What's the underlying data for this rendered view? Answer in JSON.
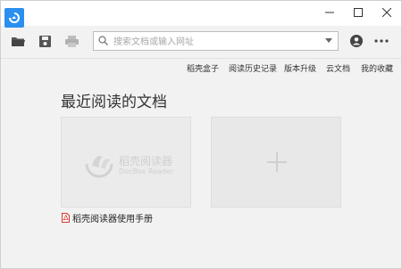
{
  "window": {
    "minimize_glyph": "—",
    "maximize_glyph": "☐",
    "close_glyph": "✕"
  },
  "toolbar": {
    "search_placeholder": "搜索文档或输入网址",
    "search_value": ""
  },
  "links": [
    "稻壳盒子",
    "阅读历史记录",
    "版本升级",
    "云文档",
    "我的收藏"
  ],
  "main": {
    "title": "最近阅读的文档",
    "recent_docs": [
      {
        "watermark_title": "稻壳阅读器",
        "watermark_subtitle": "DocBox Reader",
        "name": "稻壳阅读器使用手册"
      }
    ]
  },
  "colors": {
    "accent": "#2b8ff0",
    "pdf_red": "#d8342c"
  },
  "icons": {
    "app": "app-logo-icon",
    "open": "folder-icon",
    "save": "save-icon",
    "print": "printer-icon",
    "search": "search-icon",
    "user": "user-icon",
    "more": "more-icon",
    "pdf": "pdf-icon",
    "add": "plus-icon"
  }
}
